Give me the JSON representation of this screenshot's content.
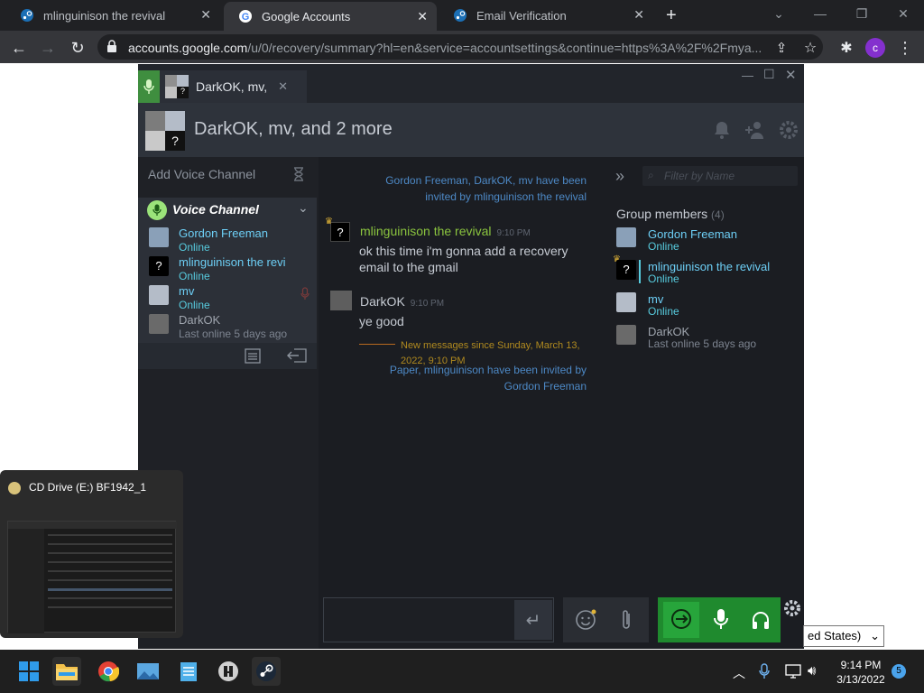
{
  "browser": {
    "tabs": [
      {
        "title": "mlinguinison the revival"
      },
      {
        "title": "Google Accounts"
      },
      {
        "title": "Email Verification"
      }
    ],
    "url_host": "accounts.google.com",
    "url_path": "/u/0/recovery/summary?hl=en&service=accountsettings&continue=https%3A%2F%2Fmya...",
    "profile_initial": "c"
  },
  "steam": {
    "chat_tab_title": "DarkOK, mv, ",
    "group_title": "DarkOK, mv, and 2 more",
    "add_voice_channel": "Add Voice Channel",
    "voice_channel_label": "Voice Channel",
    "voice_members": [
      {
        "name": "Gordon Freeman",
        "status": "Online"
      },
      {
        "name": "mlinguinison the revi",
        "status": "Online"
      },
      {
        "name": "mv",
        "status": "Online"
      },
      {
        "name": "DarkOK",
        "status": "Last online 5 days ago"
      }
    ],
    "messages": {
      "sys1": "Gordon Freeman, DarkOK, mv have been invited by mlinguinison the revival",
      "msg1_name": "mlinguinison the revival",
      "msg1_time": "9:10 PM",
      "msg1_text": "ok this time i'm gonna add a recovery email to the gmail",
      "msg2_name": "DarkOK",
      "msg2_time": "9:10 PM",
      "msg2_text": "ye good",
      "new_since": "New messages since Sunday, March 13, 2022, 9:10 PM",
      "sys2": "Paper, mlinguinison have been invited by Gordon Freeman"
    },
    "filter_placeholder": "Filter by Name",
    "members_label": "Group members",
    "members_count": "(4)",
    "members": [
      {
        "name": "Gordon Freeman",
        "status": "Online"
      },
      {
        "name": "mlinguinison the revival",
        "status": "Online"
      },
      {
        "name": "mv",
        "status": "Online"
      },
      {
        "name": "DarkOK",
        "status": "Last online 5 days ago"
      }
    ]
  },
  "thumbnail": {
    "title": "CD Drive (E:) BF1942_1"
  },
  "select_partial": "ed States)",
  "taskbar": {
    "time": "9:14 PM",
    "date": "3/13/2022",
    "notification_count": "5"
  },
  "colors": {
    "accent_green": "#1f8a2e",
    "online": "#57cbde",
    "name_blue": "#6dcff6"
  }
}
